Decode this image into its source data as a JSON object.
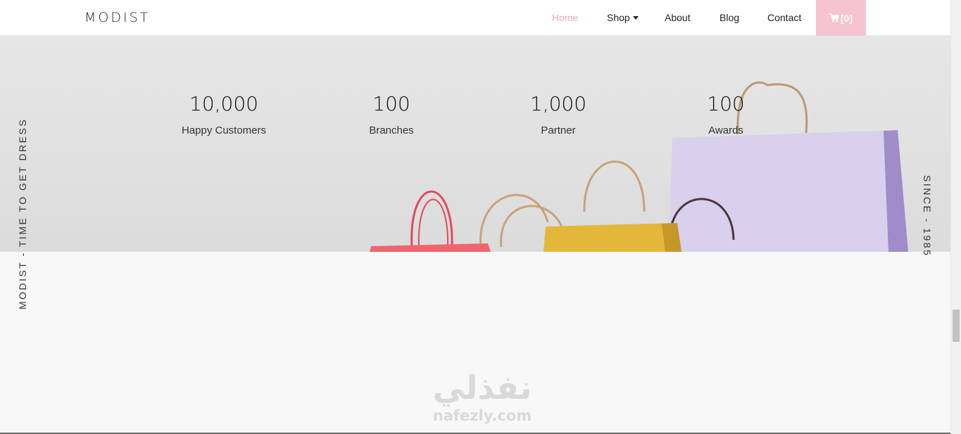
{
  "brand": "MODIST",
  "nav": {
    "home": "Home",
    "shop": "Shop",
    "about": "About",
    "blog": "Blog",
    "contact": "Contact",
    "cart": "[0]"
  },
  "stats": [
    {
      "number": "10,000",
      "label": "Happy Customers"
    },
    {
      "number": "100",
      "label": "Branches"
    },
    {
      "number": "1,000",
      "label": "Partner"
    },
    {
      "number": "100",
      "label": "Awards"
    }
  ],
  "side": {
    "left": "MODIST - TIME TO GET DRESS",
    "right": "SINCE - 1985"
  },
  "watermark": {
    "arabic": "نفذلي",
    "latin": "nafezly.com"
  },
  "colors": {
    "accent": "#f5a6c0",
    "cart_bg": "#f6c4d1"
  }
}
